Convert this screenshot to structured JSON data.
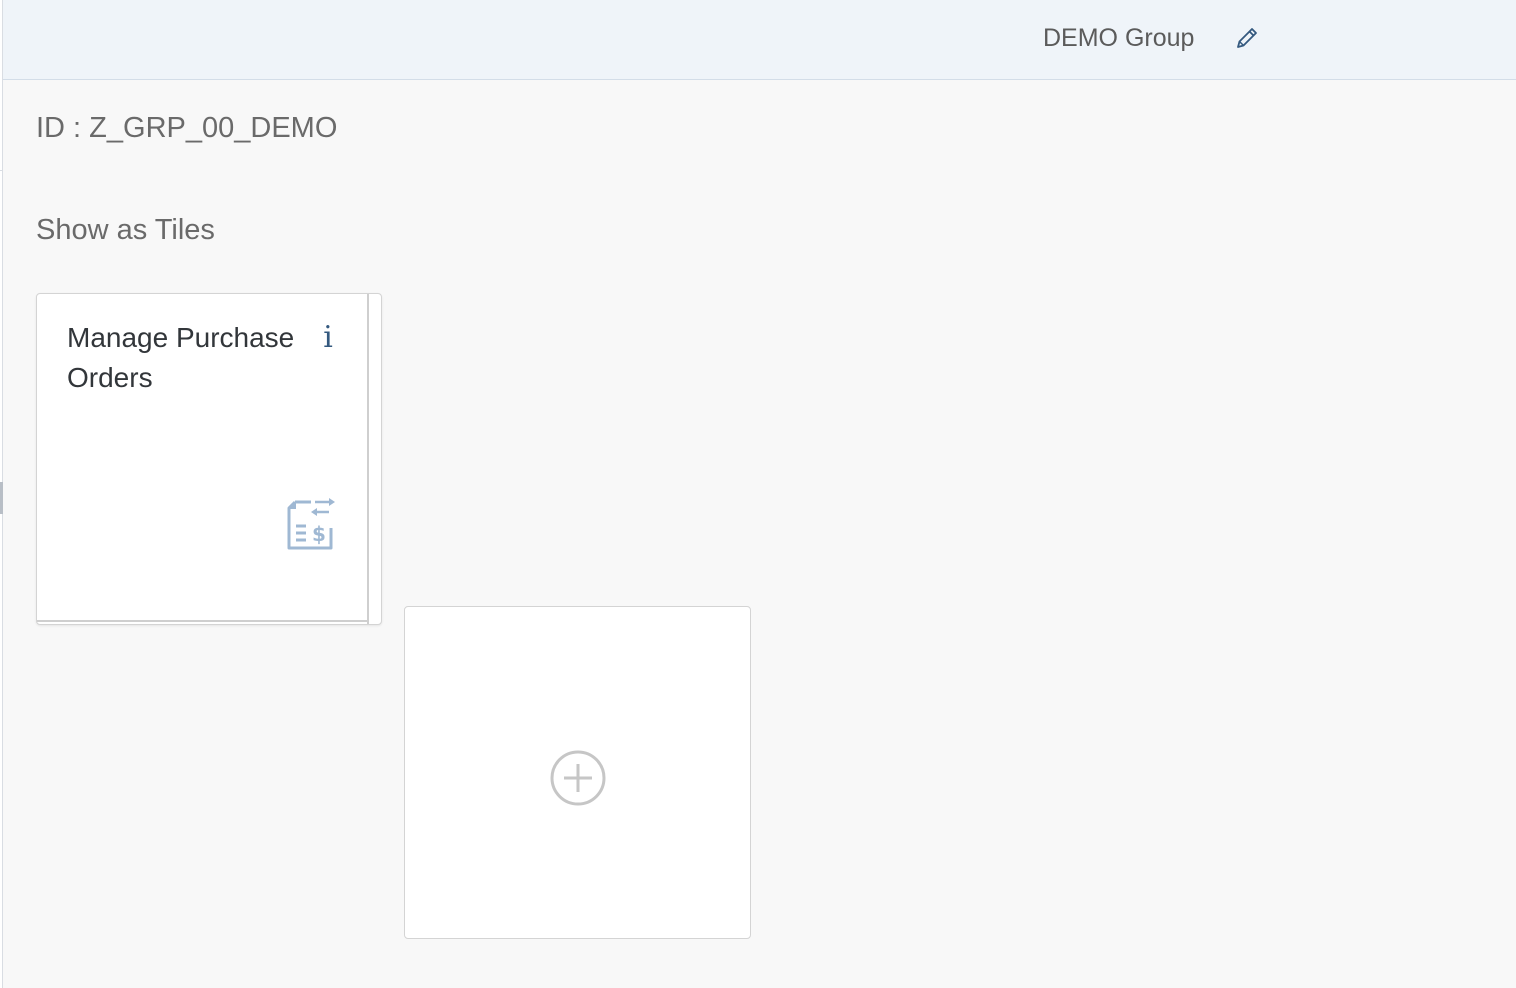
{
  "header": {
    "group_title": "DEMO Group",
    "edit_icon": "pencil-icon"
  },
  "main": {
    "group_id": "ID : Z_GRP_00_DEMO",
    "view_mode": "Show as Tiles"
  },
  "tiles": [
    {
      "title": "Manage Purchase Orders",
      "info_icon_glyph": "i",
      "info_icon": "info-icon",
      "app_icon": "purchase-order-document-icon"
    }
  ],
  "add_tile": {
    "icon": "add-circle-icon"
  },
  "colors": {
    "header_bg": "#eff4f9",
    "page_bg": "#f8f8f8",
    "accent": "#34597f",
    "icon_muted": "#9fb8d3"
  }
}
